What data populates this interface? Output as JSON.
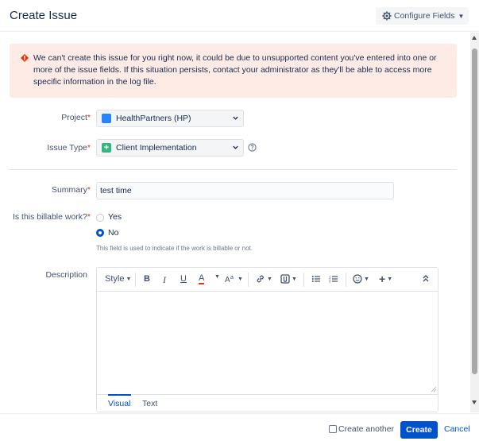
{
  "dialog": {
    "title": "Create Issue",
    "configure_fields_label": "Configure Fields"
  },
  "error": {
    "message": "We can't create this issue for you right now, it could be due to unsupported content you've entered into one or more of the issue fields. If this situation persists, contact your administrator as they'll be able to access more specific information in the log file."
  },
  "form": {
    "project": {
      "label": "Project",
      "required_mark": "*",
      "value": "HealthPartners (HP)"
    },
    "issue_type": {
      "label": "Issue Type",
      "required_mark": "*",
      "value": "Client Implementation"
    },
    "summary": {
      "label": "Summary",
      "required_mark": "*",
      "value": "test time"
    },
    "billable": {
      "label": "Is this billable work?",
      "required_mark": "*",
      "options": [
        "Yes",
        "No"
      ],
      "selected": "No",
      "hint": "This field is used to indicate if the work is billable or not."
    },
    "description": {
      "label": "Description",
      "toolbar": {
        "style_label": "Style",
        "bold": "B",
        "italic": "I",
        "underline": "U",
        "text_color": "A"
      },
      "tabs": [
        "Visual",
        "Text"
      ],
      "active_tab": "Visual"
    }
  },
  "footer": {
    "create_another_label": "Create another",
    "create_label": "Create",
    "cancel_label": "Cancel"
  },
  "colors": {
    "primary": "#0052cc",
    "error_bg": "#ffebe6",
    "error_icon": "#de350b",
    "issue_type_icon": "#36b37e",
    "project_icon": "#2684ff"
  },
  "icons": {
    "configure": "gear-icon",
    "error": "error-icon",
    "help": "help-icon"
  }
}
